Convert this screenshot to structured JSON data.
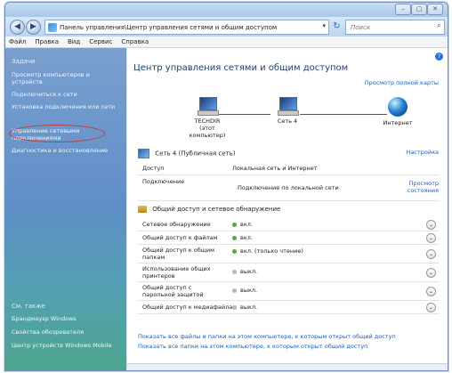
{
  "window": {
    "controls": [
      "–",
      "▢",
      "✕"
    ]
  },
  "address_bar": {
    "back_glyph": "◀",
    "forward_glyph": "▶",
    "path": "Панель управления\\Центр управления сетями и общим доступом",
    "dropdown_glyph": "▾",
    "refresh_glyph": "↻",
    "search_placeholder": "Поиск",
    "search_glyph": "⌕"
  },
  "menu": [
    "Файл",
    "Правка",
    "Вид",
    "Сервис",
    "Справка"
  ],
  "sidebar": {
    "tasks_heading": "Задачи",
    "tasks": [
      "Просмотр компьютеров и устройств",
      "Подключиться к сети",
      "Установка подключения или сети",
      "Управление сетевыми подключениями",
      "Диагностика и восстановление"
    ],
    "see_also_heading": "См. также",
    "see_also": [
      "Брандмауэр Windows",
      "Свойства обозревателя",
      "Центр устройств Windows Mobile"
    ]
  },
  "content": {
    "title": "Центр управления сетями и общим доступом",
    "help_glyph": "?",
    "full_map_link": "Просмотр полной карты",
    "map": {
      "computer_name": "TECHDIR",
      "computer_sub": "(этот компьютер)",
      "network_label": "Сеть 4",
      "internet_label": "Интернет"
    },
    "network": {
      "name": "Сеть 4 (Публичная сеть)",
      "configure_link": "Настройка",
      "rows": [
        {
          "label": "Доступ",
          "value": "Локальная сеть и Интернет"
        },
        {
          "label": "Подключение",
          "value": "Подключение по локальной сети",
          "link": "Просмотр состояния"
        }
      ]
    },
    "sharing": {
      "heading": "Общий доступ и сетевое обнаружение",
      "expand_glyph": "⌄",
      "rows": [
        {
          "label": "Сетевое обнаружение",
          "status": "вкл.",
          "on": true
        },
        {
          "label": "Общий доступ к файлам",
          "status": "вкл.",
          "on": true
        },
        {
          "label": "Общий доступ к общим папкам",
          "status": "вкл. (только чтение)",
          "on": true
        },
        {
          "label": "Использование общих принтеров",
          "status": "выкл.",
          "on": false
        },
        {
          "label": "Общий доступ с парольной защитой",
          "status": "выкл.",
          "on": false
        },
        {
          "label": "Общий доступ к медиафайлам",
          "status": "выкл.",
          "on": false
        }
      ]
    },
    "bottom_links": [
      "Показать все файлы и папки на этом компьютере, к которым открыт общий доступ",
      "Показать все папки на этом компьютере, к которым открыт общий доступ"
    ]
  },
  "colors": {
    "on_dot": "#4cae32",
    "off_dot": "#b9b9b9",
    "link": "#1a5fbb"
  }
}
